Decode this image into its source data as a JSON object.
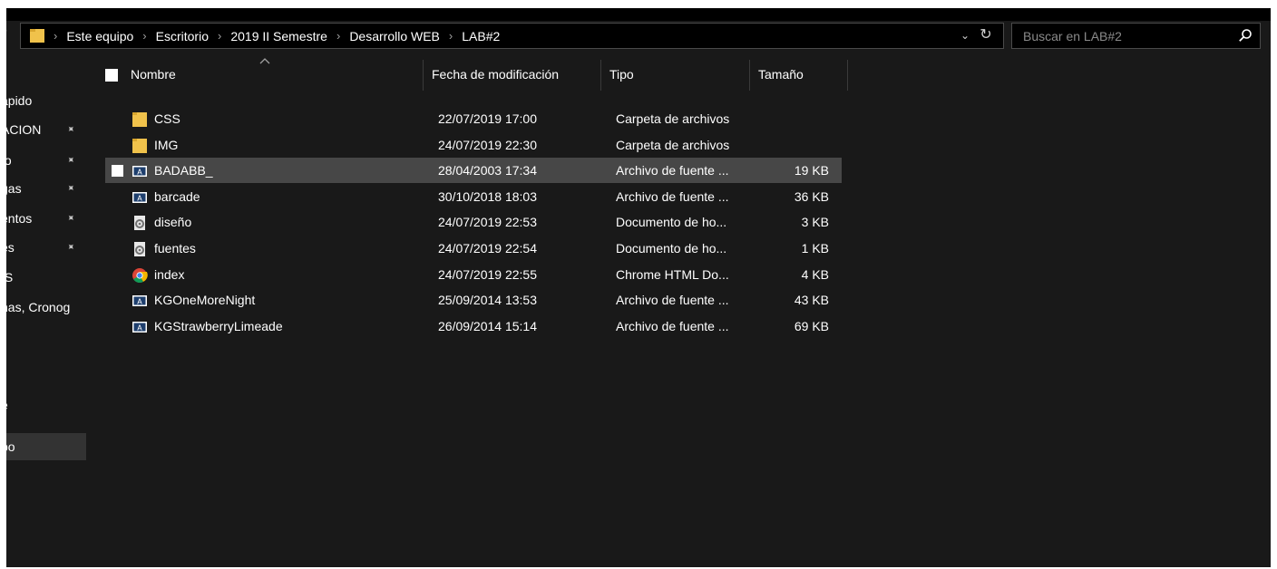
{
  "address": {
    "crumbs": [
      "Este equipo",
      "Escritorio",
      "2019 II Semestre",
      "Desarrollo WEB",
      "LAB#2"
    ],
    "separator": "›",
    "dropdown_glyph": "⌄",
    "refresh_glyph": "↻"
  },
  "search": {
    "placeholder": "Buscar en LAB#2",
    "value": ""
  },
  "nav": {
    "items": [
      {
        "label": "ápido",
        "pinned": false
      },
      {
        "label": "ACION",
        "pinned": true
      },
      {
        "label": "ío",
        "pinned": true
      },
      {
        "label": "gas",
        "pinned": true
      },
      {
        "label": "entos",
        "pinned": true
      },
      {
        "label": "es",
        "pinned": true
      },
      {
        "label": "IS",
        "pinned": false
      },
      {
        "label": "nas, Cronog",
        "pinned": false
      },
      {
        "label": "e",
        "pinned": false
      },
      {
        "label": "po",
        "pinned": false
      }
    ],
    "pin_glyph": "📌"
  },
  "columns": {
    "name": "Nombre",
    "date": "Fecha de modificación",
    "type": "Tipo",
    "size": "Tamaño"
  },
  "files": [
    {
      "name": "CSS",
      "date": "22/07/2019 17:00",
      "type": "Carpeta de archivos",
      "size": "",
      "icon": "folder-icon"
    },
    {
      "name": "IMG",
      "date": "24/07/2019 22:30",
      "type": "Carpeta de archivos",
      "size": "",
      "icon": "folder-icon"
    },
    {
      "name": "BADABB_",
      "date": "28/04/2003 17:34",
      "type": "Archivo de fuente ...",
      "size": "19 KB",
      "icon": "font-file-icon"
    },
    {
      "name": "barcade",
      "date": "30/10/2018 18:03",
      "type": "Archivo de fuente ...",
      "size": "36 KB",
      "icon": "font-file-icon"
    },
    {
      "name": "diseño",
      "date": "24/07/2019 22:53",
      "type": "Documento de ho...",
      "size": "3 KB",
      "icon": "css-document-icon"
    },
    {
      "name": "fuentes",
      "date": "24/07/2019 22:54",
      "type": "Documento de ho...",
      "size": "1 KB",
      "icon": "css-document-icon"
    },
    {
      "name": "index",
      "date": "24/07/2019 22:55",
      "type": "Chrome HTML Do...",
      "size": "4 KB",
      "icon": "chrome-icon"
    },
    {
      "name": "KGOneMoreNight",
      "date": "25/09/2014 13:53",
      "type": "Archivo de fuente ...",
      "size": "43 KB",
      "icon": "font-file-icon"
    },
    {
      "name": "KGStrawberryLimeade",
      "date": "26/09/2014 15:14",
      "type": "Archivo de fuente ...",
      "size": "69 KB",
      "icon": "font-file-icon"
    }
  ],
  "colors": {
    "background": "#191919",
    "selection": "#474747",
    "folder": "#f0c24b",
    "text": "#ffffff"
  }
}
